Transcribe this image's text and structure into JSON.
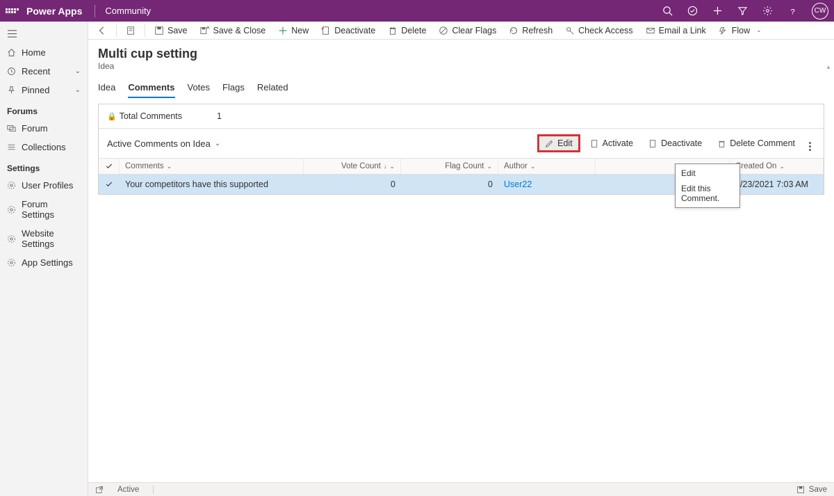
{
  "topbar": {
    "brand": "Power Apps",
    "community": "Community",
    "avatar": "CW"
  },
  "leftnav": {
    "home": "Home",
    "recent": "Recent",
    "pinned": "Pinned",
    "sections": {
      "forums": "Forums",
      "settings": "Settings"
    },
    "forum": "Forum",
    "collections": "Collections",
    "user_profiles": "User Profiles",
    "forum_settings": "Forum Settings",
    "website_settings": "Website Settings",
    "app_settings": "App Settings"
  },
  "cmdbar": {
    "save": "Save",
    "save_close": "Save & Close",
    "new": "New",
    "deactivate": "Deactivate",
    "delete": "Delete",
    "clear_flags": "Clear Flags",
    "refresh": "Refresh",
    "check_access": "Check Access",
    "email_link": "Email a Link",
    "flow": "Flow"
  },
  "page": {
    "title": "Multi cup setting",
    "subtitle": "Idea"
  },
  "tabs": {
    "idea": "Idea",
    "comments": "Comments",
    "votes": "Votes",
    "flags": "Flags",
    "related": "Related"
  },
  "totals": {
    "label": "Total Comments",
    "value": "1"
  },
  "subgrid": {
    "title": "Active Comments on Idea",
    "edit": "Edit",
    "activate": "Activate",
    "deactivate": "Deactivate",
    "delete": "Delete Comment"
  },
  "columns": {
    "comments": "Comments",
    "vote_count": "Vote Count",
    "flag_count": "Flag Count",
    "author": "Author",
    "created_on": "Created On"
  },
  "row": {
    "comment": "Your competitors have this supported",
    "vote_count": "0",
    "flag_count": "0",
    "author": "User22",
    "created_on": "9/23/2021 7:03 AM"
  },
  "tooltip": {
    "title": "Edit",
    "desc": "Edit this Comment."
  },
  "statusbar": {
    "state": "Active",
    "save": "Save"
  }
}
